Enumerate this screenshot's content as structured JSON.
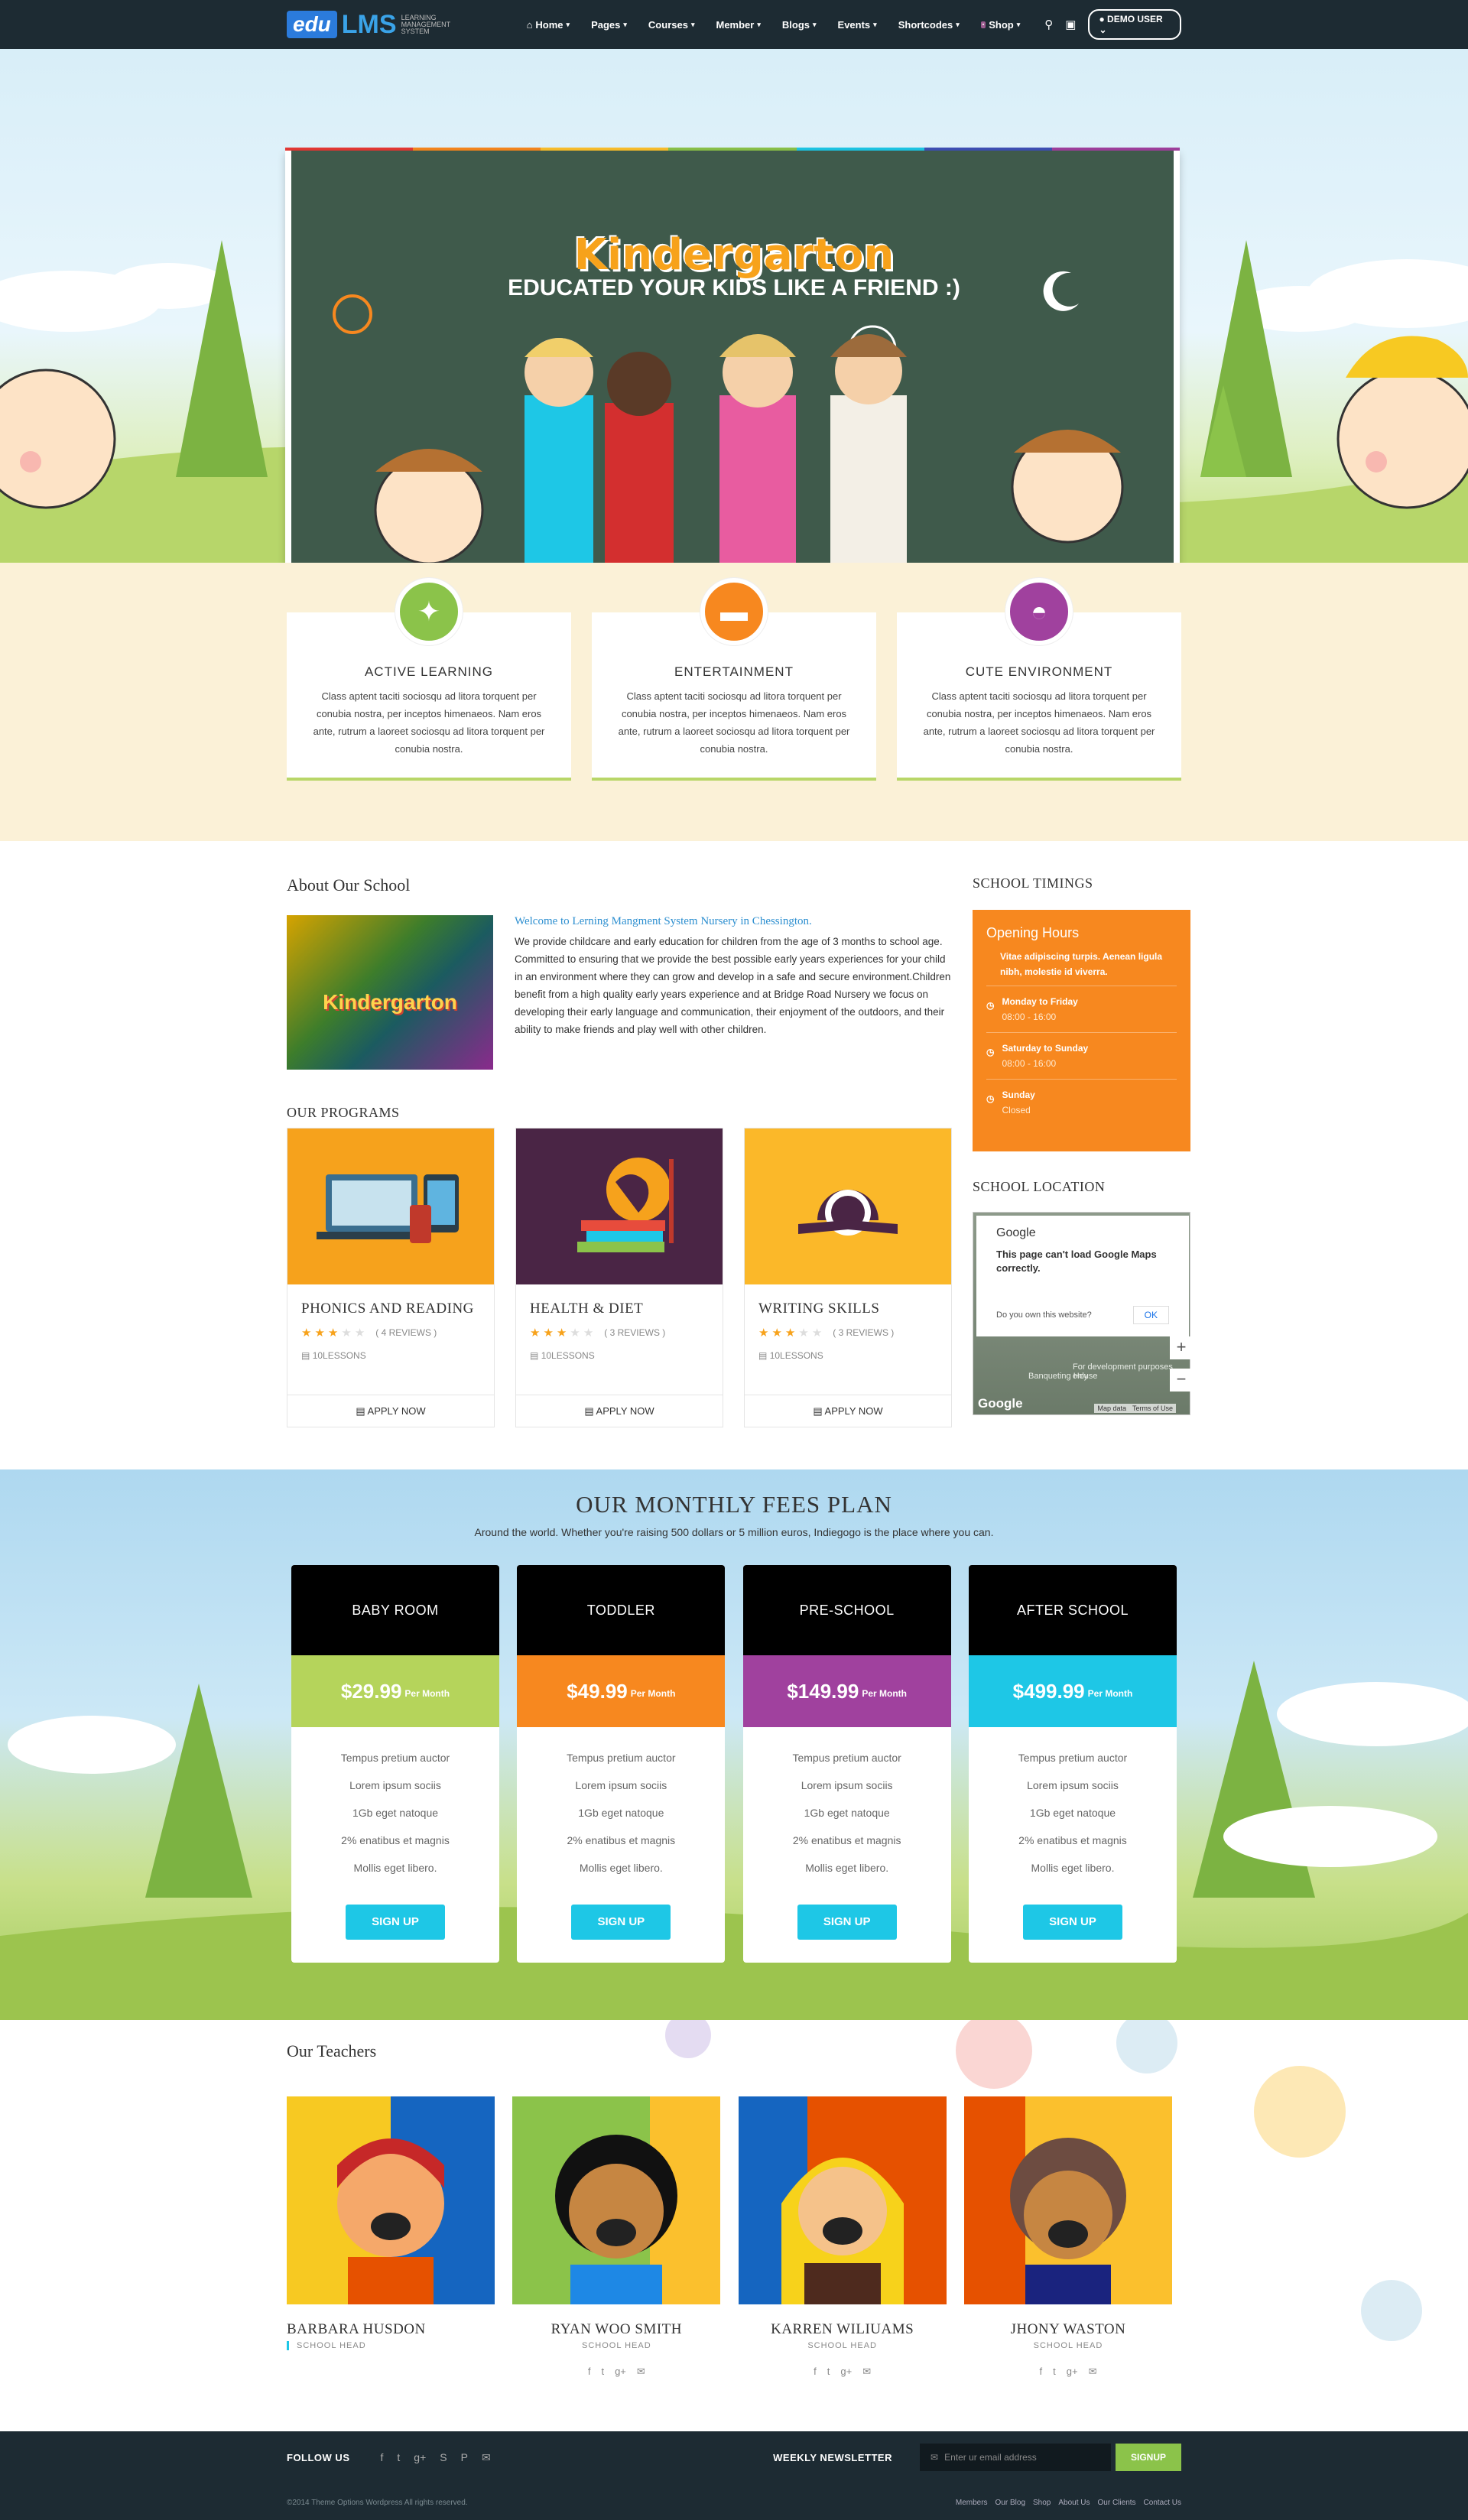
{
  "header": {
    "logo_mark": "edu",
    "logo_text": "LMS",
    "logo_tagline": "LEARNING MANAGEMENT SYSTEM",
    "nav": [
      {
        "label": "Home"
      },
      {
        "label": "Pages"
      },
      {
        "label": "Courses"
      },
      {
        "label": "Member"
      },
      {
        "label": "Blogs"
      },
      {
        "label": "Events"
      },
      {
        "label": "Shortcodes"
      },
      {
        "label": "Shop"
      }
    ],
    "user_label": "DEMO USER"
  },
  "hero": {
    "title": "Kindergarton",
    "subtitle": "EDUCATED YOUR KIDS LIKE A FRIEND :)"
  },
  "features": [
    {
      "title": "ACTIVE LEARNING",
      "text": "Class aptent taciti sociosqu ad litora torquent per conubia nostra, per inceptos himenaeos. Nam eros ante, rutrum a laoreet sociosqu ad litora torquent per conubia nostra.",
      "color": "#8bc34a",
      "icon": "magic-wand-icon"
    },
    {
      "title": "ENTERTAINMENT",
      "text": "Class aptent taciti sociosqu ad litora torquent per conubia nostra, per inceptos himenaeos. Nam eros ante, rutrum a laoreet sociosqu ad litora torquent per conubia nostra.",
      "color": "#f7881f",
      "icon": "car-icon"
    },
    {
      "title": "CUTE ENVIRONMENT",
      "text": "Class aptent taciti sociosqu ad litora torquent per conubia nostra, per inceptos himenaeos. Nam eros ante, rutrum a laoreet sociosqu ad litora torquent per conubia nostra.",
      "color": "#a0419e",
      "icon": "android-icon"
    }
  ],
  "about": {
    "heading": "About Our School",
    "image_text": "Kindergarton",
    "welcome": "Welcome to Lerning Mangment System Nursery in Chessington.",
    "body": "We provide childcare and early education for children from the age of 3 months to school age. Committed to ensuring that we provide the best possible early years experiences for your child in an environment where they can grow and develop in a safe and secure environment.Children benefit from a high quality early years experience and at Bridge Road Nursery we focus on developing their early language and communication, their enjoyment of the outdoors, and their ability to make friends and play well with other children."
  },
  "programs": {
    "heading": "OUR PROGRAMS",
    "apply_label": "APPLY NOW",
    "items": [
      {
        "title": "PHONICS AND READING",
        "rating": 3,
        "reviews": "( 4 REVIEWS )",
        "lessons": "10LESSONS",
        "bg": "#f6a21c"
      },
      {
        "title": "HEALTH & DIET",
        "rating": 3,
        "reviews": "( 3 REVIEWS )",
        "lessons": "10LESSONS",
        "bg": "#4a2545"
      },
      {
        "title": "WRITING SKILLS",
        "rating": 3,
        "reviews": "( 3 REVIEWS )",
        "lessons": "10LESSONS",
        "bg": "#fbb829"
      }
    ]
  },
  "timings": {
    "heading": "SCHOOL TIMINGS",
    "box_title": "Opening Hours",
    "intro": "Vitae adipiscing turpis. Aenean ligula nibh, molestie id viverra.",
    "rows": [
      {
        "day": "Monday to Friday",
        "hours": "08:00 - 16:00"
      },
      {
        "day": "Saturday to Sunday",
        "hours": "08:00 - 16:00"
      },
      {
        "day": "Sunday",
        "hours": "Closed"
      }
    ]
  },
  "location": {
    "heading": "SCHOOL LOCATION",
    "provider": "Google",
    "error": "This page can't load Google Maps correctly.",
    "own_question": "Do you own this website?",
    "ok": "OK",
    "map_label": "For development purposes only",
    "place": "Banqueting House",
    "logo": "Google",
    "attribution": "Map data",
    "terms": "Terms of Use"
  },
  "pricing": {
    "heading": "OUR MONTHLY FEES PLAN",
    "sub": "Around the world. Whether you're raising 500 dollars or 5 million euros, Indiegogo is the place where you can.",
    "per": "Per Month",
    "signup": "SIGN UP",
    "features": [
      "Tempus pretium auctor",
      "Lorem ipsum sociis",
      "1Gb eget natoque",
      "2% enatibus et magnis",
      "Mollis eget libero."
    ],
    "plans": [
      {
        "name": "BABY ROOM",
        "price": "$29.99",
        "color": "#b5d45b"
      },
      {
        "name": "TODDLER",
        "price": "$49.99",
        "color": "#f7881f"
      },
      {
        "name": "PRE-SCHOOL",
        "price": "$149.99",
        "color": "#a0419e"
      },
      {
        "name": "AFTER SCHOOL",
        "price": "$499.99",
        "color": "#1ec7e6"
      }
    ]
  },
  "teachers": {
    "heading": "Our Teachers",
    "items": [
      {
        "name": "BARBARA HUSDON",
        "role": "SCHOOL HEAD"
      },
      {
        "name": "RYAN WOO SMITH",
        "role": "SCHOOL HEAD"
      },
      {
        "name": "KARREN WILIUAMS",
        "role": "SCHOOL HEAD"
      },
      {
        "name": "JHONY WASTON",
        "role": "SCHOOL HEAD"
      }
    ]
  },
  "footer": {
    "follow": "FOLLOW US",
    "newsletter": "WEEKLY NEWSLETTER",
    "email_placeholder": "Enter ur email address",
    "signup": "SIGNUP",
    "copyright": "©2014 Theme Options Wordpress All rights reserved.",
    "links": [
      "Members",
      "Our Blog",
      "Shop",
      "About Us",
      "Our Clients",
      "Contact Us"
    ]
  }
}
